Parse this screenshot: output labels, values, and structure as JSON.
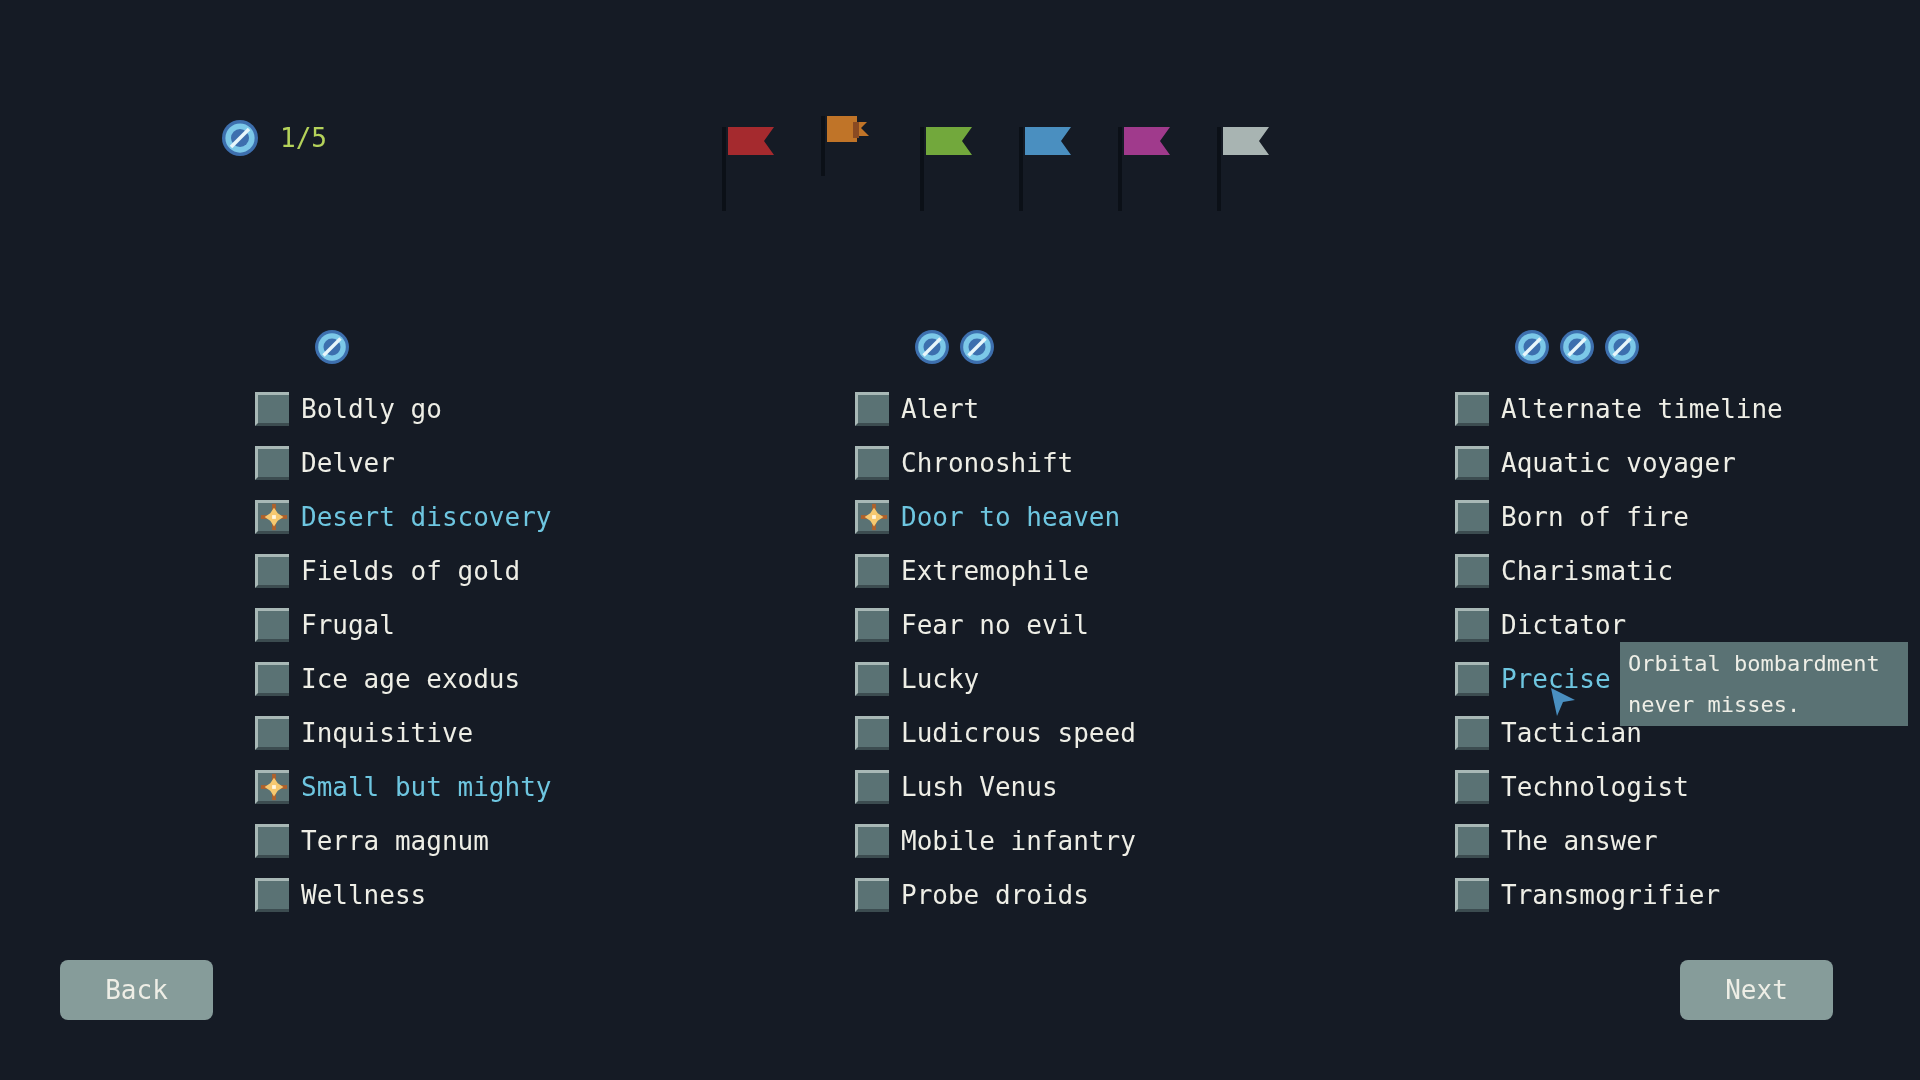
{
  "counter": {
    "text": "1/5"
  },
  "flags": [
    {
      "color": "#a52a2e",
      "selected": false
    },
    {
      "color": "#c07428",
      "selected": true
    },
    {
      "color": "#72a83c",
      "selected": false
    },
    {
      "color": "#4a8fc0",
      "selected": false
    },
    {
      "color": "#a03a8c",
      "selected": false
    },
    {
      "color": "#a8b4b2",
      "selected": false
    }
  ],
  "columns": [
    {
      "tokens": [
        {
          "kind": "orb"
        }
      ],
      "items": [
        {
          "label": "Boldly go",
          "checked": false,
          "hovered": false
        },
        {
          "label": "Delver",
          "checked": false,
          "hovered": false
        },
        {
          "label": "Desert discovery",
          "checked": true,
          "hovered": false
        },
        {
          "label": "Fields of gold",
          "checked": false,
          "hovered": false
        },
        {
          "label": "Frugal",
          "checked": false,
          "hovered": false
        },
        {
          "label": "Ice age exodus",
          "checked": false,
          "hovered": false
        },
        {
          "label": "Inquisitive",
          "checked": false,
          "hovered": false
        },
        {
          "label": "Small but mighty",
          "checked": true,
          "hovered": false
        },
        {
          "label": "Terra magnum",
          "checked": false,
          "hovered": false
        },
        {
          "label": "Wellness",
          "checked": false,
          "hovered": false
        }
      ]
    },
    {
      "tokens": [
        {
          "kind": "orb"
        },
        {
          "kind": "orb"
        }
      ],
      "items": [
        {
          "label": "Alert",
          "checked": false,
          "hovered": false
        },
        {
          "label": "Chronoshift",
          "checked": false,
          "hovered": false
        },
        {
          "label": "Door to heaven",
          "checked": true,
          "hovered": false
        },
        {
          "label": "Extremophile",
          "checked": false,
          "hovered": false
        },
        {
          "label": "Fear no evil",
          "checked": false,
          "hovered": false
        },
        {
          "label": "Lucky",
          "checked": false,
          "hovered": false
        },
        {
          "label": "Ludicrous speed",
          "checked": false,
          "hovered": false
        },
        {
          "label": "Lush Venus",
          "checked": false,
          "hovered": false
        },
        {
          "label": "Mobile infantry",
          "checked": false,
          "hovered": false
        },
        {
          "label": "Probe droids",
          "checked": false,
          "hovered": false
        }
      ]
    },
    {
      "tokens": [
        {
          "kind": "orb"
        },
        {
          "kind": "orb"
        },
        {
          "kind": "orb"
        }
      ],
      "items": [
        {
          "label": "Alternate timeline",
          "checked": false,
          "hovered": false
        },
        {
          "label": "Aquatic voyager",
          "checked": false,
          "hovered": false
        },
        {
          "label": "Born of fire",
          "checked": false,
          "hovered": false
        },
        {
          "label": "Charismatic",
          "checked": false,
          "hovered": false
        },
        {
          "label": "Dictator",
          "checked": false,
          "hovered": false
        },
        {
          "label": "Precise",
          "checked": false,
          "hovered": true,
          "tooltip": "Orbital bombardment never misses."
        },
        {
          "label": "Tactician",
          "checked": false,
          "hovered": false
        },
        {
          "label": "Technologist",
          "checked": false,
          "hovered": false
        },
        {
          "label": "The answer",
          "checked": false,
          "hovered": false
        },
        {
          "label": "Transmogrifier",
          "checked": false,
          "hovered": false
        }
      ]
    }
  ],
  "buttons": [
    {
      "label": "Back"
    },
    {
      "label": "Next"
    }
  ]
}
